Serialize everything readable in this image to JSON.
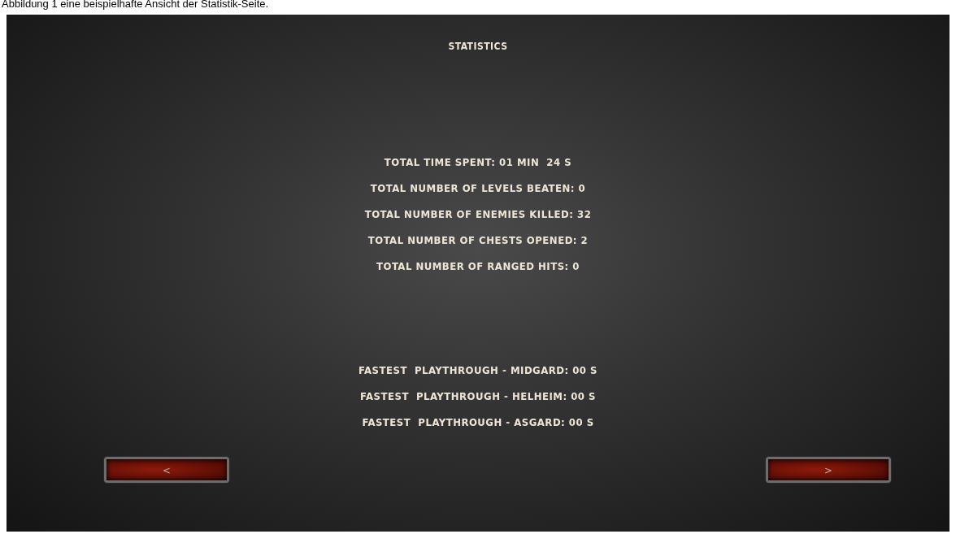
{
  "caption": "Abbildung 1 eine beispielhafte Ansicht der Statistik-Seite.",
  "screen": {
    "title": "STATISTICS",
    "totals": [
      "TOTAL TIME SPENT: 01 MIN  24 S",
      "TOTAL NUMBER OF LEVELS BEATEN: 0",
      "TOTAL NUMBER OF ENEMIES KILLED: 32",
      "TOTAL NUMBER OF CHESTS OPENED: 2",
      "TOTAL NUMBER OF RANGED HITS: 0"
    ],
    "fastest": [
      "FASTEST  PLAYTHROUGH - MIDGARD: 00 S",
      "FASTEST  PLAYTHROUGH - HELHEIM: 00 S",
      "FASTEST  PLAYTHROUGH - ASGARD: 00 S"
    ],
    "buttons": [
      {
        "label": "<",
        "kind": "previous"
      },
      {
        "label": ">",
        "kind": "next"
      }
    ]
  }
}
